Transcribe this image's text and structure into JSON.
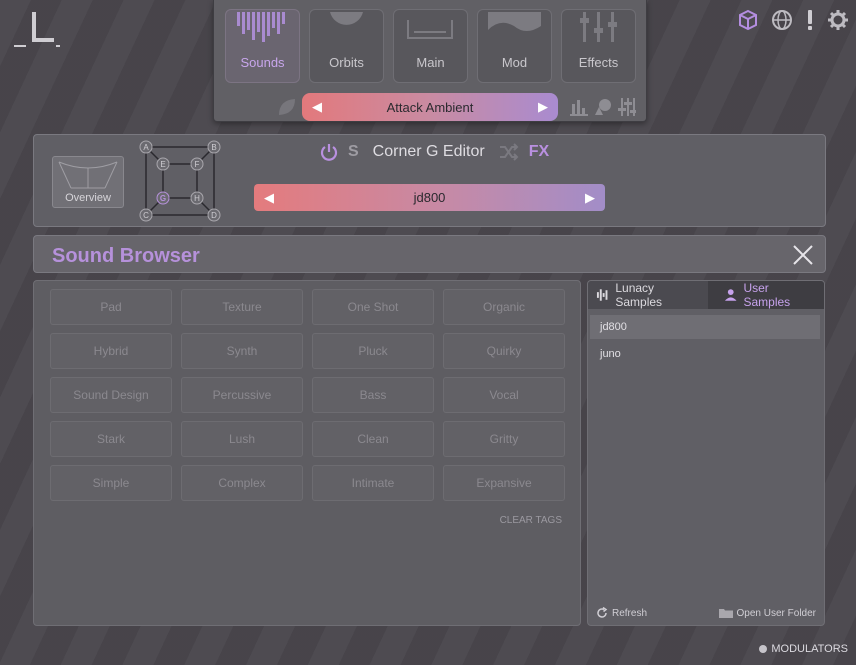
{
  "top_icons": [
    "cube-icon",
    "globe-icon",
    "exclamation-icon",
    "gear-icon"
  ],
  "nav": {
    "tabs": [
      {
        "label": "Sounds",
        "active": true
      },
      {
        "label": "Orbits",
        "active": false
      },
      {
        "label": "Main",
        "active": false
      },
      {
        "label": "Mod",
        "active": false
      },
      {
        "label": "Effects",
        "active": false
      }
    ],
    "preset": "Attack Ambient"
  },
  "editor": {
    "overview_label": "Overview",
    "grid_labels": [
      "A",
      "B",
      "E",
      "F",
      "G",
      "H",
      "C",
      "D"
    ],
    "s_label": "S",
    "title": "Corner G Editor",
    "fx_label": "FX",
    "sample": "jd800"
  },
  "browser": {
    "title": "Sound Browser",
    "tags": [
      "Pad",
      "Texture",
      "One Shot",
      "Organic",
      "Hybrid",
      "Synth",
      "Pluck",
      "Quirky",
      "Sound Design",
      "Percussive",
      "Bass",
      "Vocal",
      "Stark",
      "Lush",
      "Clean",
      "Gritty",
      "Simple",
      "Complex",
      "Intimate",
      "Expansive"
    ],
    "clear_tags": "CLEAR TAGS"
  },
  "samples": {
    "tab_lunacy": "Lunacy Samples",
    "tab_user": "User Samples",
    "items": [
      "jd800",
      "juno"
    ],
    "selected": "jd800",
    "refresh": "Refresh",
    "open_folder": "Open User Folder"
  },
  "modulators": "MODULATORS",
  "colors": {
    "accent_purple": "#b691db",
    "gradient_start": "#e3797c",
    "gradient_end": "#a98bd0"
  }
}
